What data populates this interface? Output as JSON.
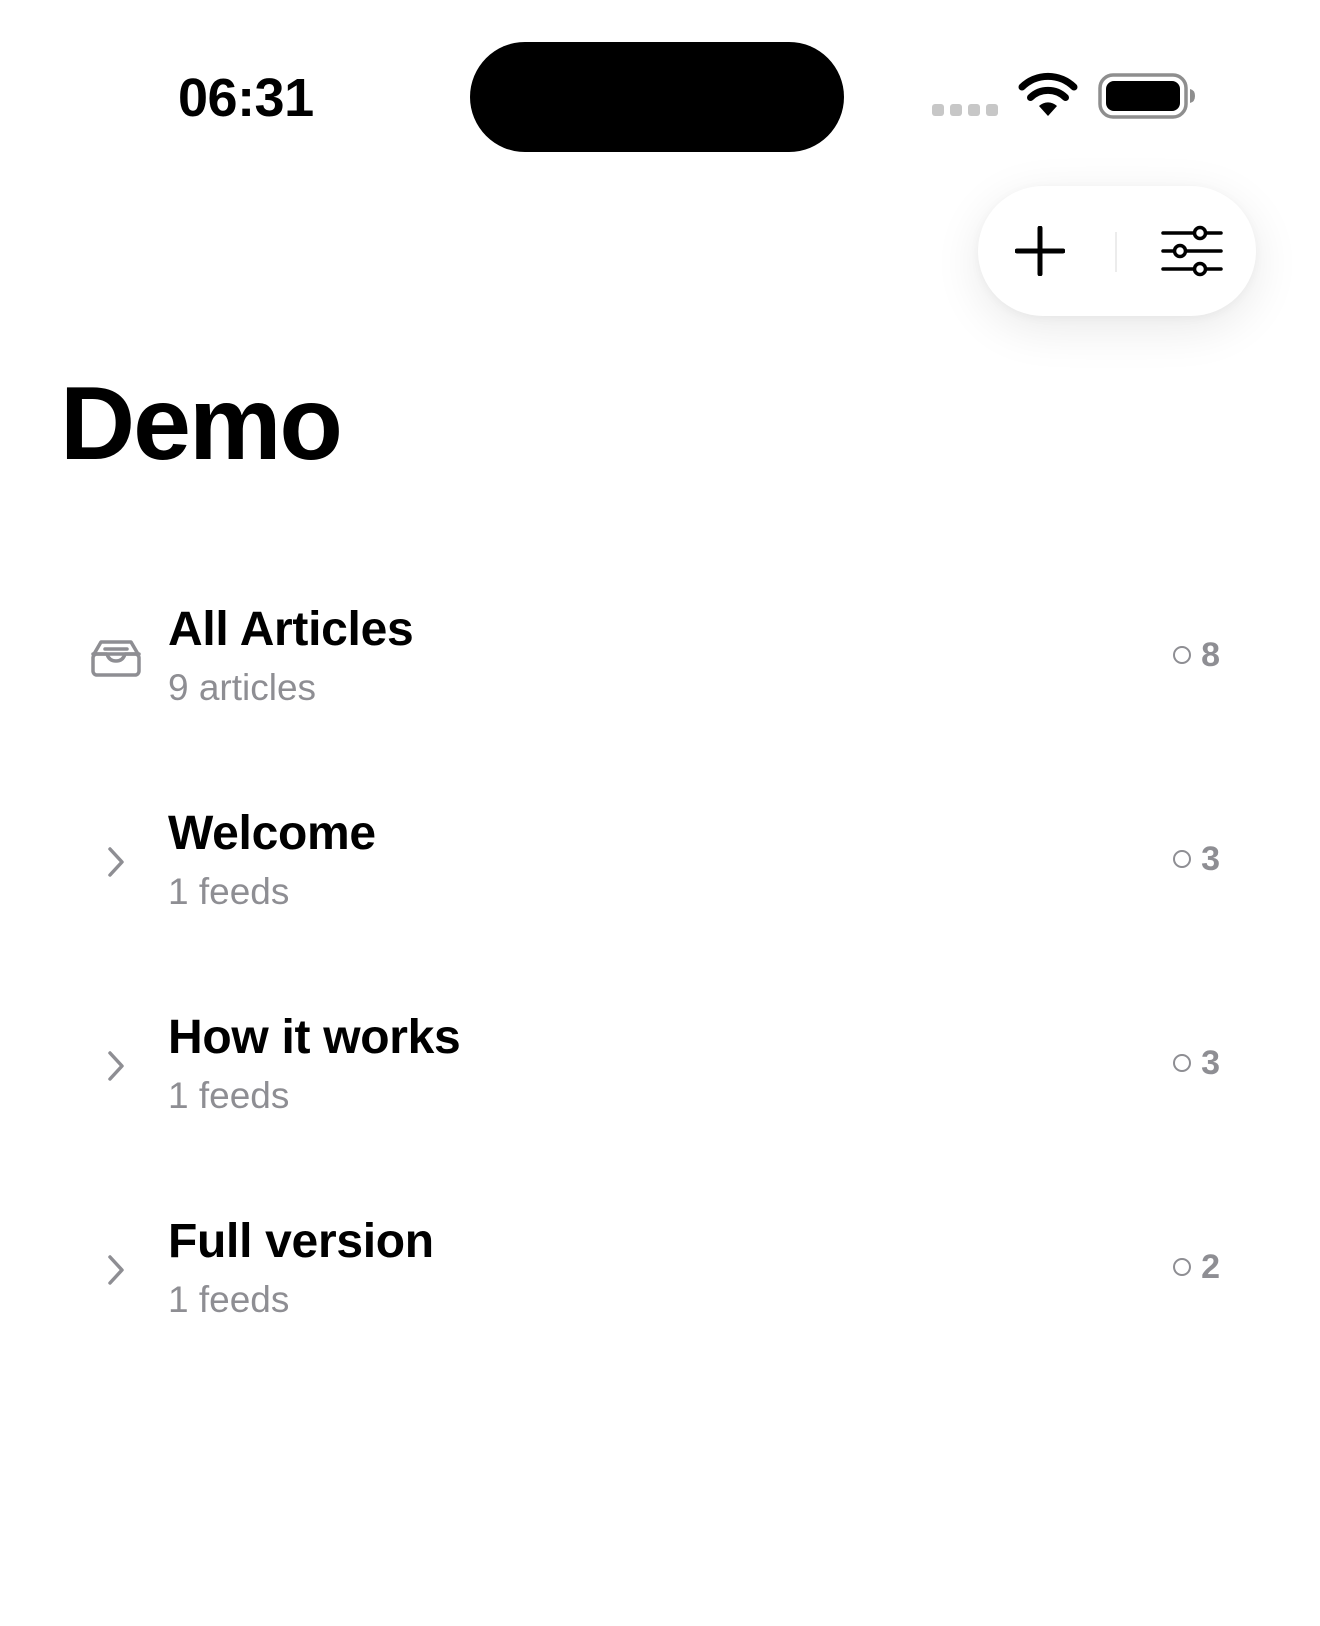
{
  "status_bar": {
    "time": "06:31"
  },
  "toolbar": {
    "add_icon": "plus-icon",
    "filter_icon": "sliders-icon"
  },
  "page": {
    "title": "Demo"
  },
  "rows": [
    {
      "icon": "inbox-tray-icon",
      "title": "All Articles",
      "subtitle": "9 articles",
      "unread": "8"
    },
    {
      "icon": "chevron-right-icon",
      "title": "Welcome",
      "subtitle": "1 feeds",
      "unread": "3"
    },
    {
      "icon": "chevron-right-icon",
      "title": "How it works",
      "subtitle": "1 feeds",
      "unread": "3"
    },
    {
      "icon": "chevron-right-icon",
      "title": "Full version",
      "subtitle": "1 feeds",
      "unread": "2"
    }
  ],
  "colors": {
    "background": "#ffffff",
    "text_primary": "#000000",
    "text_secondary": "#8e8e93"
  }
}
